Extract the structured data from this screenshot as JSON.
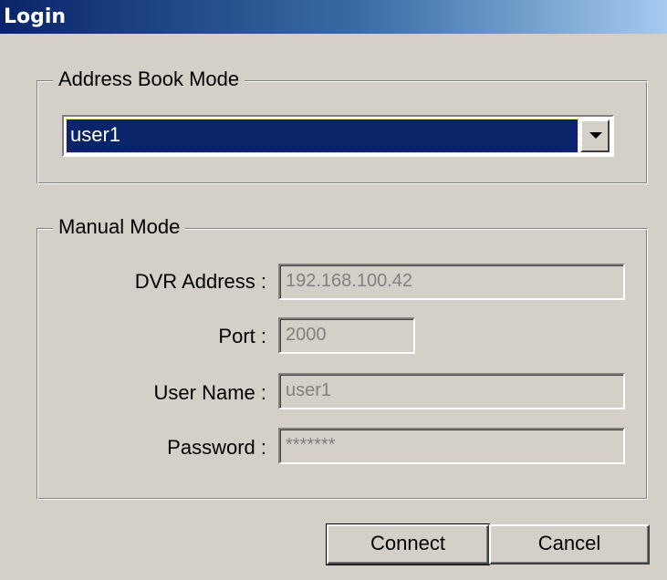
{
  "window": {
    "title": "Login"
  },
  "address_book": {
    "legend": "Address Book Mode",
    "selected_entry": "user1"
  },
  "manual": {
    "legend": "Manual Mode",
    "dvr_address_label": "DVR Address :",
    "dvr_address_value": "192.168.100.42",
    "port_label": "Port :",
    "port_value": "2000",
    "username_label": "User Name :",
    "username_value": "user1",
    "password_label": "Password :",
    "password_value": "*******"
  },
  "buttons": {
    "connect": "Connect",
    "cancel": "Cancel"
  },
  "colors": {
    "titlebar_start": "#0a246a",
    "titlebar_end": "#a6caf0",
    "selection": "#0a246a",
    "face": "#d4d0c8"
  }
}
